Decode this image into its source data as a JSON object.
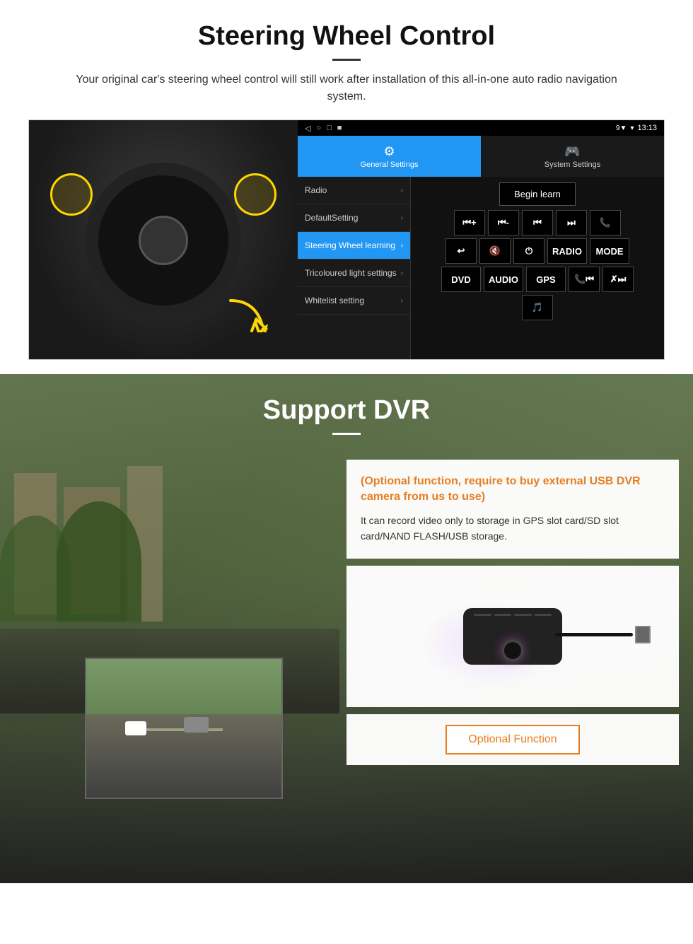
{
  "steering_section": {
    "title": "Steering Wheel Control",
    "description": "Your original car's steering wheel control will still work after installation of this all-in-one auto radio navigation system.",
    "status_bar": {
      "time": "13:13",
      "nav_icons": [
        "◁",
        "○",
        "□",
        "■"
      ]
    },
    "tabs": [
      {
        "icon": "⚙",
        "label": "General Settings",
        "active": true
      },
      {
        "icon": "🎮",
        "label": "System Settings",
        "active": false
      }
    ],
    "menu_items": [
      {
        "label": "Radio",
        "active": false
      },
      {
        "label": "DefaultSetting",
        "active": false
      },
      {
        "label": "Steering Wheel learning",
        "active": true
      },
      {
        "label": "Tricoloured light settings",
        "active": false
      },
      {
        "label": "Whitelist setting",
        "active": false
      }
    ],
    "begin_learn_label": "Begin learn",
    "ctrl_buttons_row1": [
      "⏮+",
      "⏮-",
      "⏮⏮",
      "⏭⏭",
      "📞"
    ],
    "ctrl_buttons_row2": [
      "↩",
      "🔇",
      "⏻",
      "RADIO",
      "MODE"
    ],
    "ctrl_buttons_row3": [
      "DVD",
      "AUDIO",
      "GPS",
      "📞⏮",
      "✗⏭"
    ],
    "ctrl_buttons_row4": [
      "🎵"
    ]
  },
  "dvr_section": {
    "title": "Support DVR",
    "info_title": "(Optional function, require to buy external USB DVR camera from us to use)",
    "info_text": "It can record video only to storage in GPS slot card/SD slot card/NAND FLASH/USB storage.",
    "optional_button_label": "Optional Function"
  }
}
